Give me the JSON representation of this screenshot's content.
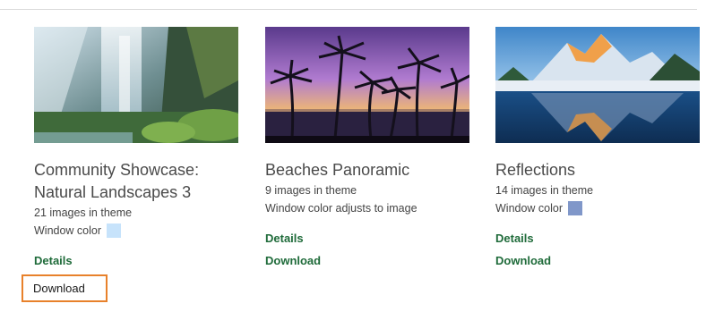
{
  "themes": [
    {
      "title": "Community Showcase: Natural Landscapes 3",
      "image_count": "21 images in theme",
      "window_color_label": "Window color",
      "window_color": "#c7e3fb",
      "details_label": "Details",
      "download_label": "Download"
    },
    {
      "title": "Beaches Panoramic",
      "image_count": "9 images in theme",
      "window_color_label": "Window color adjusts to image",
      "details_label": "Details",
      "download_label": "Download"
    },
    {
      "title": "Reflections",
      "image_count": "14 images in theme",
      "window_color_label": "Window color",
      "window_color": "#8097c9",
      "details_label": "Details",
      "download_label": "Download"
    }
  ],
  "colors": {
    "link": "#1f6b3a",
    "focus_outline": "#e8812b"
  }
}
